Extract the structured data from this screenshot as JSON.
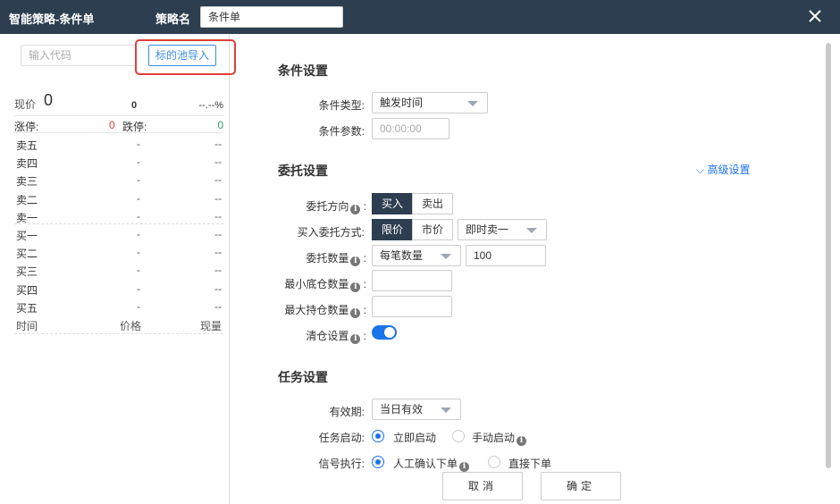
{
  "header": {
    "app_title": "智能策略-条件单",
    "name_label": "策略名",
    "name_value": "条件单"
  },
  "left": {
    "code_placeholder": "输入代码",
    "import_label": "标的池导入",
    "price_label": "现价",
    "price_value": "0",
    "volume_value": "0",
    "pct_value": "--.--%",
    "limit_up_label": "涨停:",
    "limit_up_value": "0",
    "limit_down_label": "跌停:",
    "limit_down_value": "0",
    "book": [
      {
        "label": "卖五",
        "price": "-",
        "vol": "--"
      },
      {
        "label": "卖四",
        "price": "-",
        "vol": "--"
      },
      {
        "label": "卖三",
        "price": "-",
        "vol": "--"
      },
      {
        "label": "卖二",
        "price": "-",
        "vol": "--"
      },
      {
        "label": "卖一",
        "price": "-",
        "vol": "--"
      },
      {
        "label": "买一",
        "price": "-",
        "vol": "--"
      },
      {
        "label": "买二",
        "price": "-",
        "vol": "--"
      },
      {
        "label": "买三",
        "price": "-",
        "vol": "--"
      },
      {
        "label": "买四",
        "price": "-",
        "vol": "--"
      },
      {
        "label": "买五",
        "price": "-",
        "vol": "--"
      }
    ],
    "foot": {
      "time": "时间",
      "price": "价格",
      "vol": "现量"
    }
  },
  "condition": {
    "title": "条件设置",
    "type_label": "条件类型:",
    "type_value": "触发时间",
    "param_label": "条件参数:",
    "param_placeholder": "00:00:00"
  },
  "order": {
    "title": "委托设置",
    "advanced_label": "高级设置",
    "direction_label": "委托方向",
    "buy_label": "买入",
    "sell_label": "卖出",
    "method_label": "买入委托方式:",
    "limit_label": "限价",
    "market_label": "市价",
    "method_select": "即时卖一",
    "qty_label": "委托数量",
    "qty_select": "每笔数量",
    "qty_value": "100",
    "min_pos_label": "最小底仓数量",
    "max_pos_label": "最大持仓数量",
    "clear_label": "清仓设置"
  },
  "task": {
    "title": "任务设置",
    "validity_label": "有效期:",
    "validity_value": "当日有效",
    "start_label": "任务启动:",
    "start_immediate": "立即启动",
    "start_manual": "手动启动",
    "signal_label": "信号执行:",
    "signal_manual": "人工确认下单",
    "signal_direct": "直接下单"
  },
  "footer": {
    "cancel_label": "取消",
    "ok_label": "确定"
  },
  "colors": {
    "header_bg": "#2d3e50",
    "accent": "#1a73e8",
    "limit_up": "#e0403a",
    "limit_down": "#2ea35a",
    "highlight": "#e0403a"
  }
}
